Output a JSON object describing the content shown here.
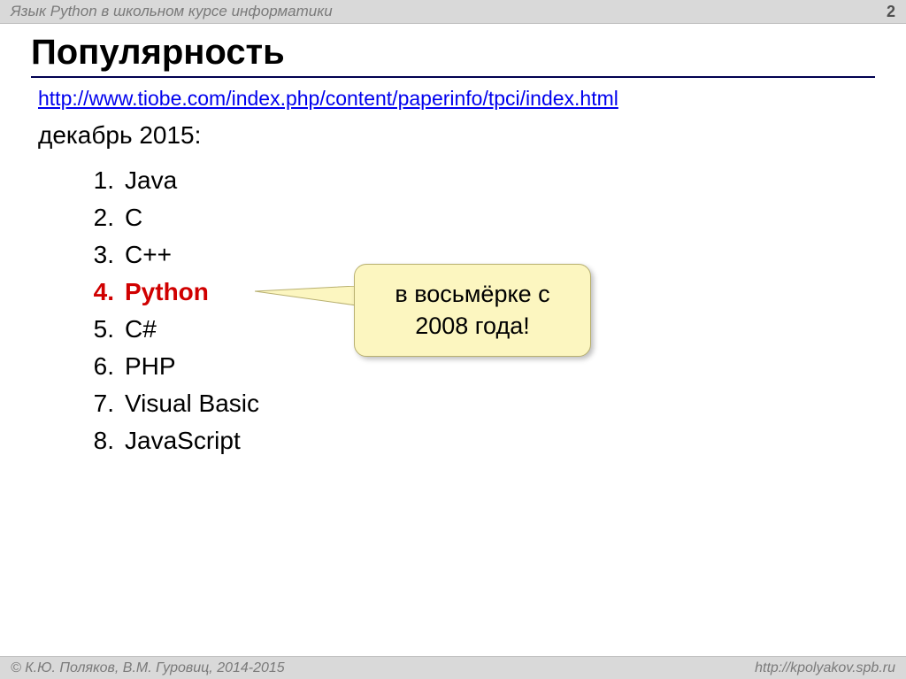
{
  "header": {
    "title": "Язык Python в школьном курсе информатики",
    "page_number": "2"
  },
  "slide": {
    "title": "Популярность",
    "link": "http://www.tiobe.com/index.php/content/paperinfo/tpci/index.html",
    "subtitle": "декабрь 2015:"
  },
  "languages": [
    {
      "num": "1.",
      "name": "Java",
      "highlight": false
    },
    {
      "num": "2.",
      "name": "C",
      "highlight": false
    },
    {
      "num": "3.",
      "name": "C++",
      "highlight": false
    },
    {
      "num": "4.",
      "name": "Python",
      "highlight": true
    },
    {
      "num": "5.",
      "name": "C#",
      "highlight": false
    },
    {
      "num": "6.",
      "name": "PHP",
      "highlight": false
    },
    {
      "num": "7.",
      "name": "Visual Basic",
      "highlight": false
    },
    {
      "num": "8.",
      "name": "JavaScript",
      "highlight": false
    }
  ],
  "callout": {
    "text": "в восьмёрке с 2008 года!"
  },
  "footer": {
    "left": "© К.Ю. Поляков, В.М. Гуровиц, 2014-2015",
    "right": "http://kpolyakov.spb.ru"
  }
}
